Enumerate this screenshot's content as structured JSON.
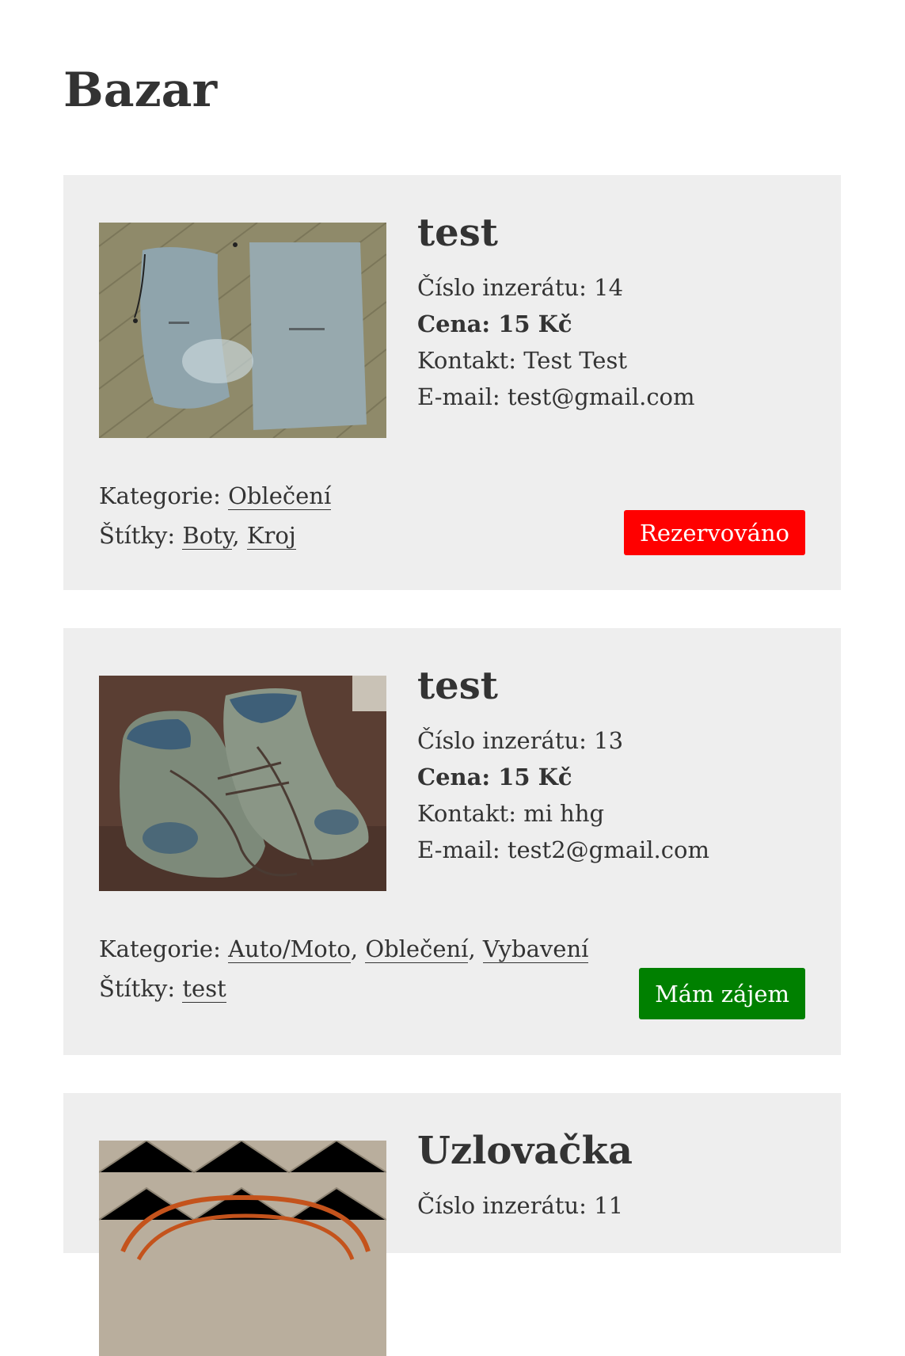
{
  "page": {
    "title": "Bazar"
  },
  "labels": {
    "number": "Číslo inzerátu:",
    "price": "Cena:",
    "contact": "Kontakt:",
    "email": "E-mail:",
    "category": "Kategorie:",
    "tags": "Štítky:",
    "separator": ","
  },
  "listings": [
    {
      "title": "test",
      "number": "14",
      "price": "15 Kč",
      "contact": "Test Test",
      "email": "test@gmail.com",
      "categories": [
        "Oblečení"
      ],
      "tags": [
        "Boty",
        "Kroj"
      ],
      "button_label": "Rezervováno",
      "button_color": "#ff0000",
      "image": "photo of two grey cloth shoe bags on a parquet floor"
    },
    {
      "title": "test",
      "number": "13",
      "price": "15 Kč",
      "contact": "mi hhg",
      "email": "test2@gmail.com",
      "categories": [
        "Auto/Moto",
        "Oblečení",
        "Vybavení"
      ],
      "tags": [
        "test"
      ],
      "button_label": "Mám zájem",
      "button_color": "#008000",
      "image": "photo of a pair of worn hiking boots"
    },
    {
      "title": "Uzlovačka",
      "number": "11",
      "image": "photo of an orange rope on a parquet floor"
    }
  ]
}
